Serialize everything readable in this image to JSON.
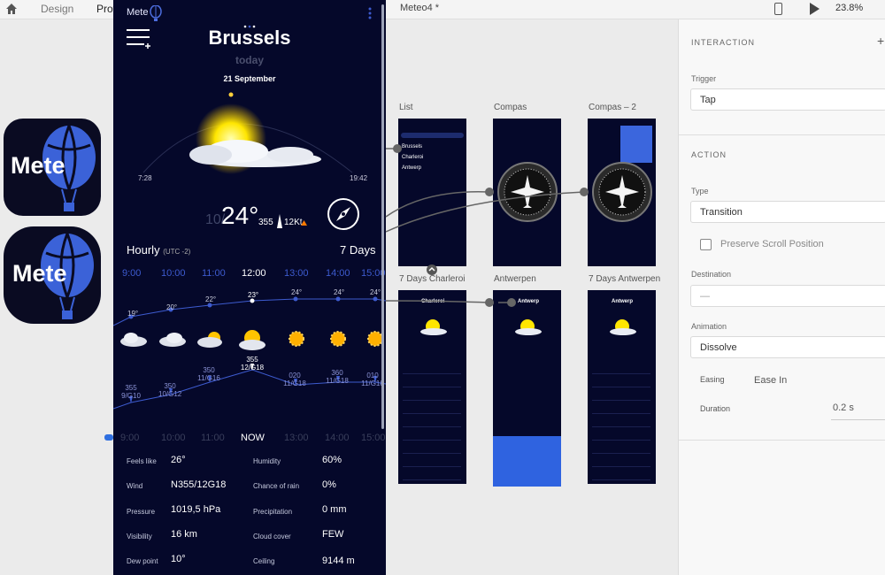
{
  "toolbar": {
    "tabs": [
      "Design",
      "Prototype"
    ],
    "doc_title": "Meteo4 *",
    "zoom": "23.8%"
  },
  "app_icons": {
    "text": "Mete"
  },
  "phone": {
    "brand": "Mete",
    "city": "Brussels",
    "subtitle": "today",
    "date": "21 September",
    "sunrise": "7:28",
    "sunset": "19:42",
    "temp_min": "10/",
    "temp_main": "24°",
    "wind_dir": "355",
    "wind_speed": "12Kt",
    "hourly_label": "Hourly",
    "utc": "(UTC -2)",
    "seven_days": "7 Days",
    "hours": [
      "9:00",
      "10:00",
      "11:00",
      "12:00",
      "13:00",
      "14:00",
      "15:00"
    ],
    "temps": [
      "19°",
      "20°",
      "22°",
      "23°",
      "24°",
      "24°",
      "24°"
    ],
    "winds": [
      "355\n9/G10",
      "350\n10/G12",
      "350\n11/G16",
      "355\n12/G18",
      "020\n11/G18",
      "360\n11/G18",
      "010\n11/G18"
    ],
    "bottom_hours": [
      "9:00",
      "10:00",
      "11:00",
      "NOW",
      "13:00",
      "14:00",
      "15:00"
    ],
    "details": [
      {
        "label": "Feels like",
        "value": "26°"
      },
      {
        "label": "Humidity",
        "value": "60%"
      },
      {
        "label": "Wind",
        "value": "N355/12G18"
      },
      {
        "label": "Chance of rain",
        "value": "0%"
      },
      {
        "label": "Pressure",
        "value": "1019,5 hPa"
      },
      {
        "label": "Precipitation",
        "value": "0 mm"
      },
      {
        "label": "Visibility",
        "value": "16 km"
      },
      {
        "label": "Cloud cover",
        "value": "FEW"
      },
      {
        "label": "Dew point",
        "value": "10°"
      },
      {
        "label": "Ceiling",
        "value": "9144 m"
      }
    ]
  },
  "artboards": {
    "list": "List",
    "compas": "Compas",
    "compas2": "Compas – 2",
    "charleroi": "7 Days Charleroi",
    "antwerpen": "Antwerpen",
    "antwerpen7": "7 Days Antwerpen",
    "list_items": [
      "Brussels",
      "Charleroi",
      "Antwerp"
    ],
    "mini_cities": [
      "Charleroi",
      "Antwerp",
      "Antwerp"
    ]
  },
  "panel": {
    "interaction": "INTERACTION",
    "trigger_label": "Trigger",
    "trigger_value": "Tap",
    "action": "ACTION",
    "type_label": "Type",
    "type_value": "Transition",
    "preserve": "Preserve Scroll Position",
    "destination_label": "Destination",
    "destination_value": "—",
    "animation_label": "Animation",
    "animation_value": "Dissolve",
    "easing_label": "Easing",
    "easing_value": "Ease In",
    "duration_label": "Duration",
    "duration_value": "0.2 s"
  },
  "colors": {
    "phone_bg": "#05082a",
    "accent_blue": "#3d5bcf",
    "wind_orange": "#ff7a00"
  }
}
